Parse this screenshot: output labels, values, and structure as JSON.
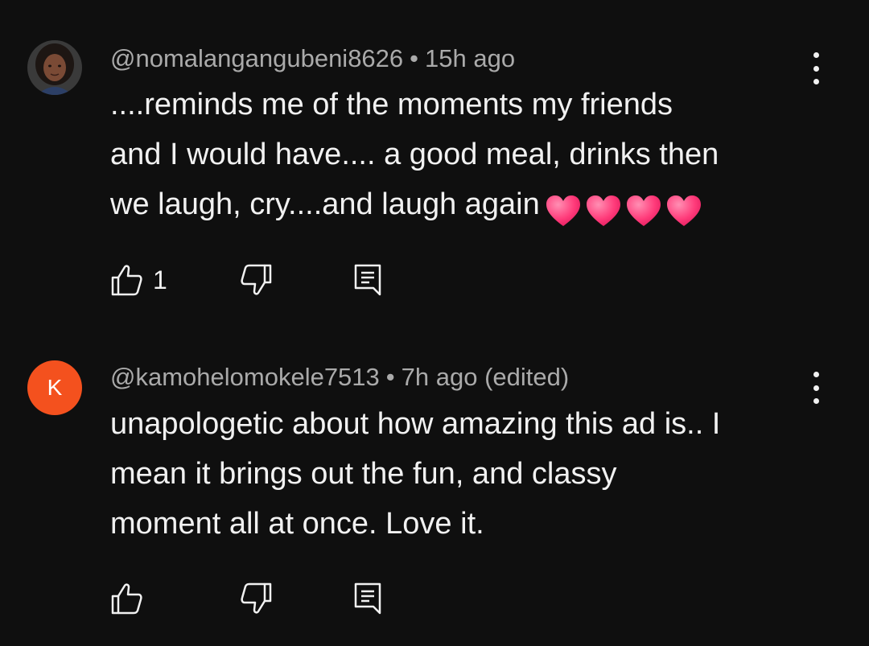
{
  "comments": [
    {
      "author": "@nomalangangubeni8626",
      "separator": "•",
      "time": "15h ago",
      "text": "....reminds me of the moments   my friends\nand I would have.... a good meal, drinks then\nwe laugh, cry....and laugh again",
      "emoji_icons": [
        "heart-icon",
        "heart-icon",
        "heart-icon",
        "heart-icon"
      ],
      "like_count": "1",
      "avatar": "photo"
    },
    {
      "author": "@kamohelomokele7513",
      "separator": "•",
      "time": "7h ago (edited)",
      "text": "unapologetic about how amazing this ad is.. I\nmean it brings out the fun, and classy\nmoment all at once. Love it.",
      "avatar_letter": "K",
      "avatar_color": "#f4511e"
    }
  ],
  "colors": {
    "background": "#0f0f0f",
    "primary_text": "#f1f1f1",
    "secondary_text": "#aaaaaa",
    "heart": "#ff3b7a"
  }
}
